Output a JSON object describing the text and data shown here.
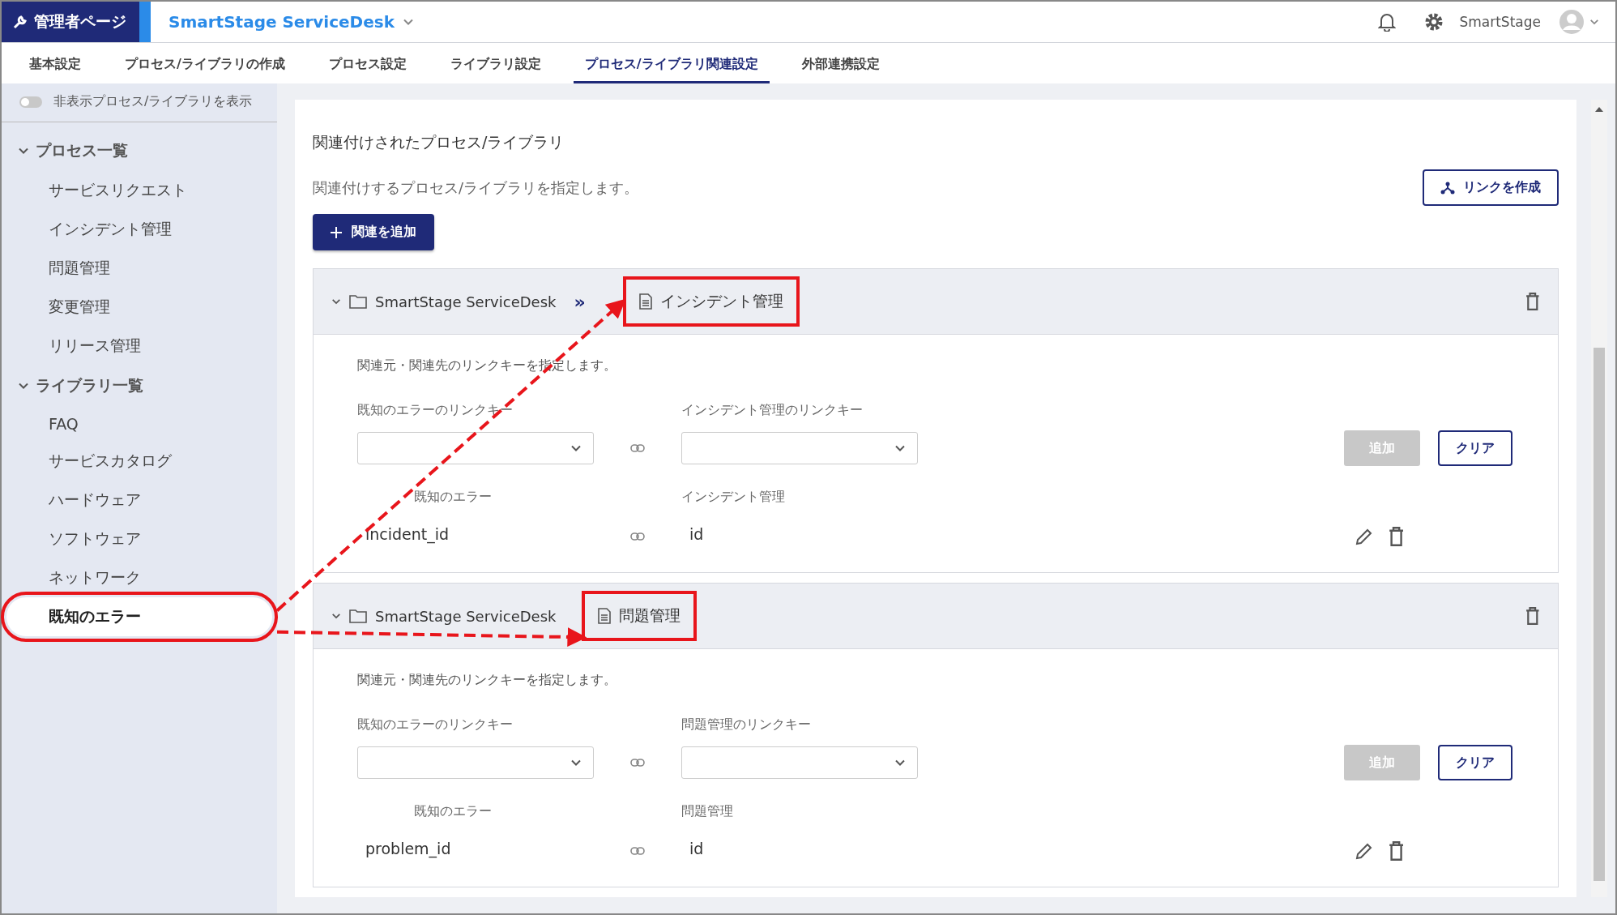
{
  "header": {
    "admin_label": "管理者ページ",
    "app_title": "SmartStage ServiceDesk",
    "user_name": "SmartStage"
  },
  "tabs": [
    {
      "label": "基本設定",
      "selected": false
    },
    {
      "label": "プロセス/ライブラリの作成",
      "selected": false
    },
    {
      "label": "プロセス設定",
      "selected": false
    },
    {
      "label": "ライブラリ設定",
      "selected": false
    },
    {
      "label": "プロセス/ライブラリ関連設定",
      "selected": true
    },
    {
      "label": "外部連携設定",
      "selected": false
    }
  ],
  "sidebar": {
    "toggle": {
      "label": "非表示プロセス/ライブラリを表示",
      "on": false
    },
    "groups": [
      {
        "label": "プロセス一覧",
        "expanded": true,
        "items": [
          {
            "label": "サービスリクエスト",
            "selected": false,
            "highlighted": false
          },
          {
            "label": "インシデント管理",
            "selected": false,
            "highlighted": false
          },
          {
            "label": "問題管理",
            "selected": false,
            "highlighted": false
          },
          {
            "label": "変更管理",
            "selected": false,
            "highlighted": false
          },
          {
            "label": "リリース管理",
            "selected": false,
            "highlighted": false
          }
        ]
      },
      {
        "label": "ライブラリ一覧",
        "expanded": true,
        "items": [
          {
            "label": "FAQ",
            "selected": false,
            "highlighted": false
          },
          {
            "label": "サービスカタログ",
            "selected": false,
            "highlighted": false
          },
          {
            "label": "ハードウェア",
            "selected": false,
            "highlighted": false
          },
          {
            "label": "ソフトウェア",
            "selected": false,
            "highlighted": false
          },
          {
            "label": "ネットワーク",
            "selected": false,
            "highlighted": false
          },
          {
            "label": "既知のエラー",
            "selected": true,
            "highlighted": true
          }
        ]
      }
    ]
  },
  "main": {
    "title": "関連付けされたプロセス/ライブラリ",
    "description": "関連付けするプロセス/ライブラリを指定します。",
    "create_link_button": "リンクを作成",
    "add_relation_button": "関連を追加",
    "relations": [
      {
        "expanded": true,
        "source": "SmartStage ServiceDesk",
        "separator": "»",
        "target": "インシデント管理",
        "highlighted": true,
        "note": "関連元・関連先のリンクキーを指定します。",
        "source_key_label": "既知のエラーのリンクキー",
        "target_key_label": "インシデント管理のリンクキー",
        "add_button": "追加",
        "add_disabled": true,
        "clear_button": "クリア",
        "source_label": "既知のエラー",
        "target_label": "インシデント管理",
        "links": [
          {
            "source": "incident_id",
            "target": "id"
          }
        ]
      },
      {
        "expanded": true,
        "source": "SmartStage ServiceDesk",
        "target": "問題管理",
        "highlighted": true,
        "note": "関連元・関連先のリンクキーを指定します。",
        "source_key_label": "既知のエラーのリンクキー",
        "target_key_label": "問題管理のリンクキー",
        "add_button": "追加",
        "add_disabled": true,
        "clear_button": "クリア",
        "source_label": "既知のエラー",
        "target_label": "問題管理",
        "links": [
          {
            "source": "problem_id",
            "target": "id"
          }
        ]
      }
    ]
  }
}
